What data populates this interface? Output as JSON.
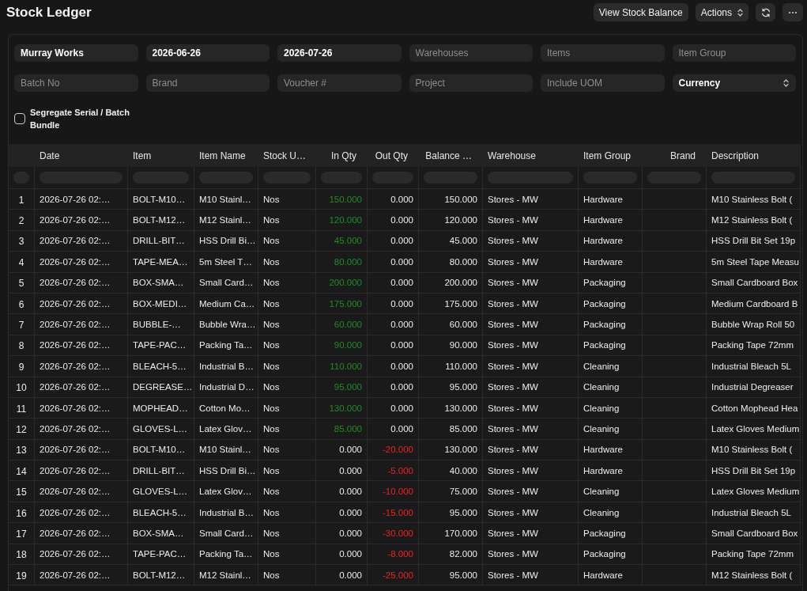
{
  "page": {
    "title": "Stock Ledger"
  },
  "toolbar": {
    "buttons": [
      {
        "kind": "text",
        "label": "View Stock Balance"
      },
      {
        "kind": "dropdown",
        "label": "Actions"
      },
      {
        "kind": "refresh"
      },
      {
        "kind": "more"
      }
    ]
  },
  "filters": {
    "fields": [
      {
        "kind": "input",
        "value": "Murray Works"
      },
      {
        "kind": "input",
        "value": "2026-06-26"
      },
      {
        "kind": "input",
        "value": "2026-07-26"
      },
      {
        "kind": "input",
        "placeholder": "Warehouses"
      },
      {
        "kind": "input",
        "placeholder": "Items"
      },
      {
        "kind": "input",
        "placeholder": "Item Group"
      },
      {
        "kind": "input",
        "placeholder": "Batch No"
      },
      {
        "kind": "input",
        "placeholder": "Brand"
      },
      {
        "kind": "input",
        "placeholder": "Voucher #"
      },
      {
        "kind": "input",
        "placeholder": "Project"
      },
      {
        "kind": "input",
        "placeholder": "Include UOM"
      },
      {
        "kind": "select",
        "value": "Currency"
      }
    ],
    "checkbox": {
      "label": "Segregate Serial / Batch Bundle",
      "checked": false
    }
  },
  "table": {
    "columns": [
      {
        "label": "Date",
        "kind": "text"
      },
      {
        "label": "Item",
        "kind": "text"
      },
      {
        "label": "Item Name",
        "kind": "text"
      },
      {
        "label": "Stock U…",
        "kind": "text"
      },
      {
        "label": "In Qty",
        "kind": "number"
      },
      {
        "label": "Out Qty",
        "kind": "number"
      },
      {
        "label": "Balance …",
        "kind": "number"
      },
      {
        "label": "Warehouse",
        "kind": "text"
      },
      {
        "label": "Item Group",
        "kind": "text"
      },
      {
        "label": "Brand",
        "kind": "number"
      },
      {
        "label": "Description",
        "kind": "text"
      }
    ],
    "rows": [
      {
        "index": "1",
        "date": "2026-07-26 02:…",
        "item": "BOLT-M10…",
        "item_name": "M10 Stainl…",
        "stock_uom": "Nos",
        "in_qty": {
          "value": "150.000",
          "color": "#238b23"
        },
        "out_qty": {
          "value": "0.000"
        },
        "balance_qty": "150.000",
        "warehouse": "Stores - MW",
        "item_group": "Hardware",
        "description": "M10 Stainless Bolt ("
      },
      {
        "index": "2",
        "date": "2026-07-26 02:…",
        "item": "BOLT-M12…",
        "item_name": "M12 Stainl…",
        "stock_uom": "Nos",
        "in_qty": {
          "value": "120.000",
          "color": "#238b23"
        },
        "out_qty": {
          "value": "0.000"
        },
        "balance_qty": "120.000",
        "warehouse": "Stores - MW",
        "item_group": "Hardware",
        "description": "M12 Stainless Bolt ("
      },
      {
        "index": "3",
        "date": "2026-07-26 02:…",
        "item": "DRILL-BIT…",
        "item_name": "HSS Drill Bi…",
        "stock_uom": "Nos",
        "in_qty": {
          "value": "45.000",
          "color": "#238b23"
        },
        "out_qty": {
          "value": "0.000"
        },
        "balance_qty": "45.000",
        "warehouse": "Stores - MW",
        "item_group": "Hardware",
        "description": "HSS Drill Bit Set 19p"
      },
      {
        "index": "4",
        "date": "2026-07-26 02:…",
        "item": "TAPE-MEA…",
        "item_name": "5m Steel T…",
        "stock_uom": "Nos",
        "in_qty": {
          "value": "80.000",
          "color": "#238b23"
        },
        "out_qty": {
          "value": "0.000"
        },
        "balance_qty": "80.000",
        "warehouse": "Stores - MW",
        "item_group": "Hardware",
        "description": "5m Steel Tape Measu"
      },
      {
        "index": "5",
        "date": "2026-07-26 02:…",
        "item": "BOX-SMA…",
        "item_name": "Small Card…",
        "stock_uom": "Nos",
        "in_qty": {
          "value": "200.000",
          "color": "#238b23"
        },
        "out_qty": {
          "value": "0.000"
        },
        "balance_qty": "200.000",
        "warehouse": "Stores - MW",
        "item_group": "Packaging",
        "description": "Small Cardboard Box"
      },
      {
        "index": "6",
        "date": "2026-07-26 02:…",
        "item": "BOX-MEDI…",
        "item_name": "Medium Ca…",
        "stock_uom": "Nos",
        "in_qty": {
          "value": "175.000",
          "color": "#238b23"
        },
        "out_qty": {
          "value": "0.000"
        },
        "balance_qty": "175.000",
        "warehouse": "Stores - MW",
        "item_group": "Packaging",
        "description": "Medium Cardboard B"
      },
      {
        "index": "7",
        "date": "2026-07-26 02:…",
        "item": "BUBBLE-…",
        "item_name": "Bubble Wra…",
        "stock_uom": "Nos",
        "in_qty": {
          "value": "60.000",
          "color": "#238b23"
        },
        "out_qty": {
          "value": "0.000"
        },
        "balance_qty": "60.000",
        "warehouse": "Stores - MW",
        "item_group": "Packaging",
        "description": "Bubble Wrap Roll 50"
      },
      {
        "index": "8",
        "date": "2026-07-26 02:…",
        "item": "TAPE-PAC…",
        "item_name": "Packing Ta…",
        "stock_uom": "Nos",
        "in_qty": {
          "value": "90.000",
          "color": "#238b23"
        },
        "out_qty": {
          "value": "0.000"
        },
        "balance_qty": "90.000",
        "warehouse": "Stores - MW",
        "item_group": "Packaging",
        "description": "Packing Tape 72mm"
      },
      {
        "index": "9",
        "date": "2026-07-26 02:…",
        "item": "BLEACH-5…",
        "item_name": "Industrial B…",
        "stock_uom": "Nos",
        "in_qty": {
          "value": "110.000",
          "color": "#238b23"
        },
        "out_qty": {
          "value": "0.000"
        },
        "balance_qty": "110.000",
        "warehouse": "Stores - MW",
        "item_group": "Cleaning",
        "description": "Industrial Bleach 5L"
      },
      {
        "index": "10",
        "date": "2026-07-26 02:…",
        "item": "DEGREASE…",
        "item_name": "Industrial D…",
        "stock_uom": "Nos",
        "in_qty": {
          "value": "95.000",
          "color": "#238b23"
        },
        "out_qty": {
          "value": "0.000"
        },
        "balance_qty": "95.000",
        "warehouse": "Stores - MW",
        "item_group": "Cleaning",
        "description": "Industrial Degreaser"
      },
      {
        "index": "11",
        "date": "2026-07-26 02:…",
        "item": "MOPHEAD…",
        "item_name": "Cotton Mo…",
        "stock_uom": "Nos",
        "in_qty": {
          "value": "130.000",
          "color": "#238b23"
        },
        "out_qty": {
          "value": "0.000"
        },
        "balance_qty": "130.000",
        "warehouse": "Stores - MW",
        "item_group": "Cleaning",
        "description": "Cotton Mophead Hea"
      },
      {
        "index": "12",
        "date": "2026-07-26 02:…",
        "item": "GLOVES-L…",
        "item_name": "Latex Glov…",
        "stock_uom": "Nos",
        "in_qty": {
          "value": "85.000",
          "color": "#238b23"
        },
        "out_qty": {
          "value": "0.000"
        },
        "balance_qty": "85.000",
        "warehouse": "Stores - MW",
        "item_group": "Cleaning",
        "description": "Latex Gloves Medium"
      },
      {
        "index": "13",
        "date": "2026-07-26 02:…",
        "item": "BOLT-M10…",
        "item_name": "M10 Stainl…",
        "stock_uom": "Nos",
        "in_qty": {
          "value": "0.000"
        },
        "out_qty": {
          "value": "-20.000",
          "color": "#ee2222"
        },
        "balance_qty": "130.000",
        "warehouse": "Stores - MW",
        "item_group": "Hardware",
        "description": "M10 Stainless Bolt ("
      },
      {
        "index": "14",
        "date": "2026-07-26 02:…",
        "item": "DRILL-BIT…",
        "item_name": "HSS Drill Bi…",
        "stock_uom": "Nos",
        "in_qty": {
          "value": "0.000"
        },
        "out_qty": {
          "value": "-5.000",
          "color": "#ee2222"
        },
        "balance_qty": "40.000",
        "warehouse": "Stores - MW",
        "item_group": "Hardware",
        "description": "HSS Drill Bit Set 19p"
      },
      {
        "index": "15",
        "date": "2026-07-26 02:…",
        "item": "GLOVES-L…",
        "item_name": "Latex Glov…",
        "stock_uom": "Nos",
        "in_qty": {
          "value": "0.000"
        },
        "out_qty": {
          "value": "-10.000",
          "color": "#ee2222"
        },
        "balance_qty": "75.000",
        "warehouse": "Stores - MW",
        "item_group": "Cleaning",
        "description": "Latex Gloves Medium"
      },
      {
        "index": "16",
        "date": "2026-07-26 02:…",
        "item": "BLEACH-5…",
        "item_name": "Industrial B…",
        "stock_uom": "Nos",
        "in_qty": {
          "value": "0.000"
        },
        "out_qty": {
          "value": "-15.000",
          "color": "#ee2222"
        },
        "balance_qty": "95.000",
        "warehouse": "Stores - MW",
        "item_group": "Cleaning",
        "description": "Industrial Bleach 5L"
      },
      {
        "index": "17",
        "date": "2026-07-26 02:…",
        "item": "BOX-SMA…",
        "item_name": "Small Card…",
        "stock_uom": "Nos",
        "in_qty": {
          "value": "0.000"
        },
        "out_qty": {
          "value": "-30.000",
          "color": "#ee2222"
        },
        "balance_qty": "170.000",
        "warehouse": "Stores - MW",
        "item_group": "Packaging",
        "description": "Small Cardboard Box"
      },
      {
        "index": "18",
        "date": "2026-07-26 02:…",
        "item": "TAPE-PAC…",
        "item_name": "Packing Ta…",
        "stock_uom": "Nos",
        "in_qty": {
          "value": "0.000"
        },
        "out_qty": {
          "value": "-8.000",
          "color": "#ee2222"
        },
        "balance_qty": "82.000",
        "warehouse": "Stores - MW",
        "item_group": "Packaging",
        "description": "Packing Tape 72mm"
      },
      {
        "index": "19",
        "date": "2026-07-26 02:…",
        "item": "BOLT-M12…",
        "item_name": "M12 Stainl…",
        "stock_uom": "Nos",
        "in_qty": {
          "value": "0.000"
        },
        "out_qty": {
          "value": "-25.000",
          "color": "#ee2222"
        },
        "balance_qty": "95.000",
        "warehouse": "Stores - MW",
        "item_group": "Hardware",
        "description": "M12 Stainless Bolt ("
      }
    ]
  }
}
